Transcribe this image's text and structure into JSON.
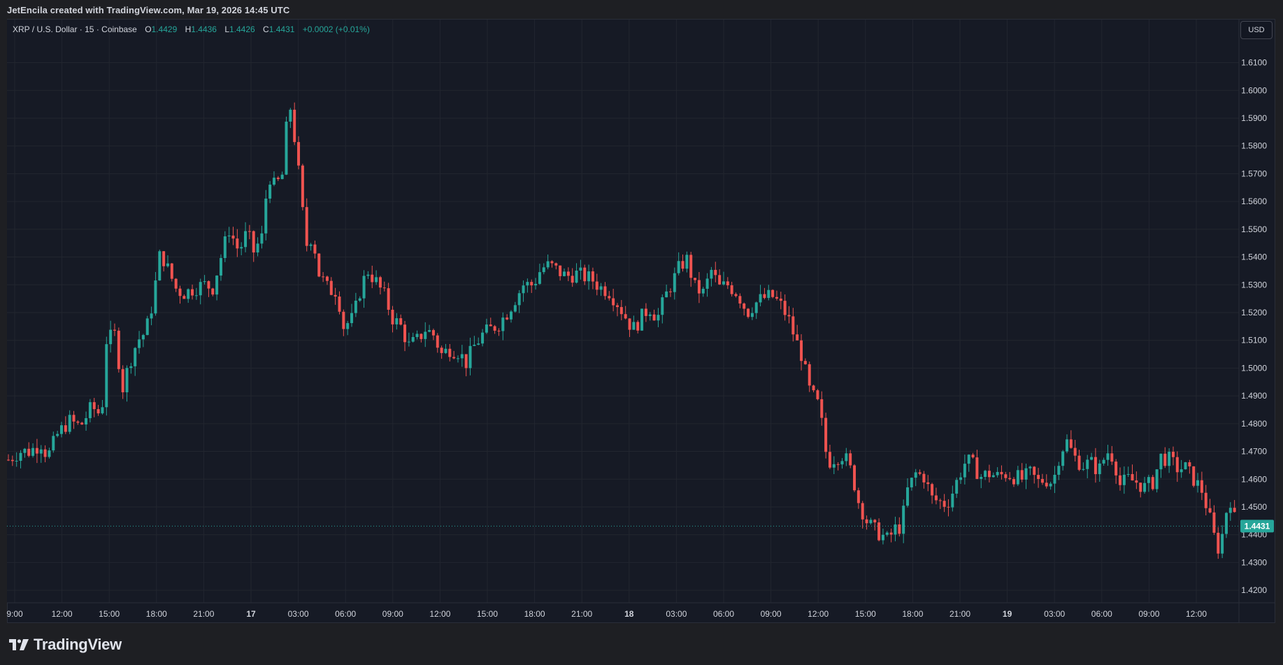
{
  "header": {
    "attribution": "JetEncila created with TradingView.com, Mar 19, 2026 14:45 UTC"
  },
  "legend": {
    "symbol": "XRP / U.S. Dollar · 15 · Coinbase",
    "open_label": "O",
    "open": "1.4429",
    "high_label": "H",
    "high": "1.4436",
    "low_label": "L",
    "low": "1.4426",
    "close_label": "C",
    "close": "1.4431",
    "change": "+0.0002 (+0.01%)"
  },
  "currency_button": {
    "label": "USD"
  },
  "branding": {
    "logo_text": "TradingView"
  },
  "colors": {
    "up": "#26a69a",
    "down": "#ef5350",
    "grid": "#22262f",
    "axis_text": "#d1d4dc",
    "last_price_bg": "#26a69a"
  },
  "chart_data": {
    "type": "candlestick",
    "symbol": "XRP / U.S. Dollar",
    "interval": "15",
    "exchange": "Coinbase",
    "ylim": [
      1.4155,
      1.6255
    ],
    "y_ticks": [
      1.42,
      1.43,
      1.44,
      1.45,
      1.46,
      1.47,
      1.48,
      1.49,
      1.5,
      1.51,
      1.52,
      1.53,
      1.54,
      1.55,
      1.56,
      1.57,
      1.58,
      1.59,
      1.6,
      1.61
    ],
    "y_tick_labels": [
      "1.4200",
      "1.4300",
      "1.4400",
      "1.4500",
      "1.4600",
      "1.4700",
      "1.4800",
      "1.4900",
      "1.5000",
      "1.5100",
      "1.5200",
      "1.5300",
      "1.5400",
      "1.5500",
      "1.5600",
      "1.5700",
      "1.5800",
      "1.5900",
      "1.6000",
      "1.6100"
    ],
    "x_ticks": [
      "9:00",
      "12:00",
      "15:00",
      "18:00",
      "21:00",
      "17",
      "03:00",
      "06:00",
      "09:00",
      "12:00",
      "15:00",
      "18:00",
      "21:00",
      "18",
      "03:00",
      "06:00",
      "09:00",
      "12:00",
      "15:00",
      "18:00",
      "21:00",
      "19",
      "03:00",
      "06:00",
      "09:00",
      "12:00"
    ],
    "x_tick_bold": [
      "17",
      "18",
      "19"
    ],
    "last_price": 1.4431,
    "last_price_label": "1.4431",
    "grid": true,
    "close_path": [
      [
        0,
        1.467
      ],
      [
        14,
        1.47
      ],
      [
        26,
        1.47
      ],
      [
        40,
        1.473
      ],
      [
        48,
        1.468
      ],
      [
        60,
        1.476
      ],
      [
        74,
        1.481
      ],
      [
        88,
        1.479
      ],
      [
        102,
        1.486
      ],
      [
        114,
        1.483
      ],
      [
        120,
        1.51
      ],
      [
        130,
        1.512
      ],
      [
        140,
        1.493
      ],
      [
        148,
        1.502
      ],
      [
        158,
        1.51
      ],
      [
        168,
        1.513
      ],
      [
        176,
        1.523
      ],
      [
        186,
        1.542
      ],
      [
        196,
        1.535
      ],
      [
        206,
        1.528
      ],
      [
        216,
        1.527
      ],
      [
        228,
        1.529
      ],
      [
        240,
        1.53
      ],
      [
        250,
        1.529
      ],
      [
        260,
        1.54
      ],
      [
        270,
        1.55
      ],
      [
        282,
        1.542
      ],
      [
        292,
        1.549
      ],
      [
        300,
        1.542
      ],
      [
        310,
        1.547
      ],
      [
        318,
        1.57
      ],
      [
        326,
        1.565
      ],
      [
        336,
        1.57
      ],
      [
        343,
        1.598
      ],
      [
        350,
        1.583
      ],
      [
        356,
        1.568
      ],
      [
        364,
        1.544
      ],
      [
        372,
        1.548
      ],
      [
        380,
        1.534
      ],
      [
        392,
        1.528
      ],
      [
        402,
        1.528
      ],
      [
        410,
        1.515
      ],
      [
        422,
        1.518
      ],
      [
        432,
        1.53
      ],
      [
        440,
        1.535
      ],
      [
        450,
        1.531
      ],
      [
        460,
        1.526
      ],
      [
        470,
        1.518
      ],
      [
        480,
        1.515
      ],
      [
        490,
        1.508
      ],
      [
        500,
        1.51
      ],
      [
        510,
        1.514
      ],
      [
        520,
        1.512
      ],
      [
        530,
        1.505
      ],
      [
        540,
        1.507
      ],
      [
        550,
        1.506
      ],
      [
        560,
        1.502
      ],
      [
        570,
        1.508
      ],
      [
        580,
        1.512
      ],
      [
        590,
        1.514
      ],
      [
        600,
        1.516
      ],
      [
        610,
        1.52
      ],
      [
        620,
        1.525
      ],
      [
        630,
        1.53
      ],
      [
        642,
        1.53
      ],
      [
        652,
        1.536
      ],
      [
        662,
        1.537
      ],
      [
        672,
        1.535
      ],
      [
        682,
        1.533
      ],
      [
        694,
        1.534
      ],
      [
        704,
        1.533
      ],
      [
        714,
        1.532
      ],
      [
        724,
        1.529
      ],
      [
        734,
        1.528
      ],
      [
        744,
        1.524
      ],
      [
        754,
        1.519
      ],
      [
        764,
        1.514
      ],
      [
        774,
        1.518
      ],
      [
        784,
        1.522
      ],
      [
        794,
        1.518
      ],
      [
        804,
        1.526
      ],
      [
        814,
        1.532
      ],
      [
        822,
        1.537
      ],
      [
        830,
        1.539
      ],
      [
        840,
        1.529
      ],
      [
        850,
        1.527
      ],
      [
        860,
        1.535
      ],
      [
        870,
        1.529
      ],
      [
        880,
        1.53
      ],
      [
        892,
        1.527
      ],
      [
        904,
        1.52
      ],
      [
        912,
        1.523
      ],
      [
        922,
        1.525
      ],
      [
        934,
        1.526
      ],
      [
        944,
        1.523
      ],
      [
        954,
        1.518
      ],
      [
        962,
        1.511
      ],
      [
        970,
        1.505
      ],
      [
        980,
        1.492
      ],
      [
        992,
        1.486
      ],
      [
        1002,
        1.466
      ],
      [
        1012,
        1.468
      ],
      [
        1022,
        1.469
      ],
      [
        1032,
        1.462
      ],
      [
        1040,
        1.452
      ],
      [
        1050,
        1.445
      ],
      [
        1058,
        1.442
      ],
      [
        1068,
        1.44
      ],
      [
        1076,
        1.438
      ],
      [
        1084,
        1.442
      ],
      [
        1092,
        1.443
      ],
      [
        1100,
        1.456
      ],
      [
        1110,
        1.462
      ],
      [
        1120,
        1.461
      ],
      [
        1130,
        1.453
      ],
      [
        1138,
        1.452
      ],
      [
        1148,
        1.451
      ],
      [
        1156,
        1.456
      ],
      [
        1164,
        1.462
      ],
      [
        1172,
        1.467
      ],
      [
        1180,
        1.465
      ],
      [
        1190,
        1.461
      ],
      [
        1200,
        1.462
      ],
      [
        1210,
        1.461
      ],
      [
        1220,
        1.462
      ],
      [
        1230,
        1.461
      ],
      [
        1240,
        1.46
      ],
      [
        1250,
        1.462
      ],
      [
        1260,
        1.459
      ],
      [
        1268,
        1.46
      ],
      [
        1278,
        1.459
      ],
      [
        1286,
        1.469
      ],
      [
        1294,
        1.474
      ],
      [
        1304,
        1.468
      ],
      [
        1314,
        1.465
      ],
      [
        1324,
        1.466
      ],
      [
        1334,
        1.463
      ],
      [
        1344,
        1.47
      ],
      [
        1352,
        1.468
      ],
      [
        1360,
        1.458
      ],
      [
        1370,
        1.46
      ],
      [
        1380,
        1.459
      ],
      [
        1390,
        1.457
      ],
      [
        1400,
        1.459
      ],
      [
        1410,
        1.468
      ],
      [
        1420,
        1.467
      ],
      [
        1430,
        1.464
      ],
      [
        1440,
        1.464
      ],
      [
        1450,
        1.46
      ],
      [
        1460,
        1.456
      ],
      [
        1468,
        1.448
      ],
      [
        1476,
        1.438
      ],
      [
        1482,
        1.434
      ],
      [
        1488,
        1.446
      ],
      [
        1494,
        1.454
      ],
      [
        1502,
        1.443
      ]
    ]
  }
}
